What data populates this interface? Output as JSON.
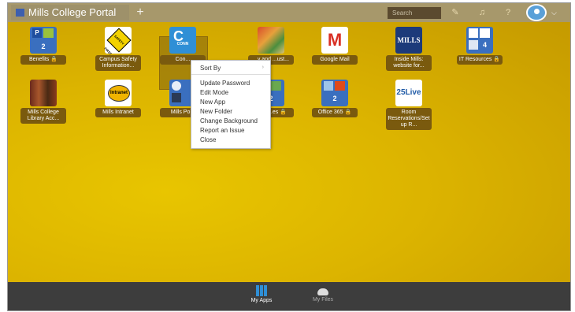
{
  "topbar": {
    "tab_title": "Mills College Portal",
    "add_tab": "+",
    "search_placeholder": "Search",
    "icons": [
      "edit-icon",
      "bell-icon",
      "help-icon"
    ],
    "help_glyph": "?",
    "caret": "⌵"
  },
  "apps": [
    {
      "label": "Benefits",
      "lock": true,
      "badge": "2"
    },
    {
      "label": "Campus Safety Information..."
    },
    {
      "label": "Con..."
    },
    {
      "label": "...y and ...ust..."
    },
    {
      "label": "Google Mail"
    },
    {
      "label": "Inside Mills: website for..."
    },
    {
      "label": "IT Resources",
      "lock": true,
      "badge": "4"
    },
    {
      "label": "Mills College Library Acc..."
    },
    {
      "label": "Mills Intranet"
    },
    {
      "label": "Mills Po..."
    },
    {
      "label": "...ills ...es",
      "lock": true,
      "badge": "2"
    },
    {
      "label": "Office 365",
      "lock": true,
      "badge": "2"
    },
    {
      "label": "Room Reservations/Set up R..."
    }
  ],
  "tile_text": {
    "safety_sign": "SAFETY FIRST",
    "intranet": "Intranet",
    "mills": "MILLS",
    "live25": "25Live",
    "connect": "CONN"
  },
  "context_menu": {
    "items": [
      "Sort By",
      "Update Password",
      "Edit Mode",
      "New App",
      "New Folder",
      "Change Background",
      "Report an Issue",
      "Close"
    ],
    "submenu_arrow": "›"
  },
  "bottombar": {
    "my_apps": "My Apps",
    "my_files": "My Files"
  },
  "colors": {
    "topbar": "#a7986b",
    "desktop": "#dcb400",
    "label_bg": "#7a5a0e",
    "bottombar": "#3d3d3d",
    "accent_blue": "#2f8fd6"
  }
}
